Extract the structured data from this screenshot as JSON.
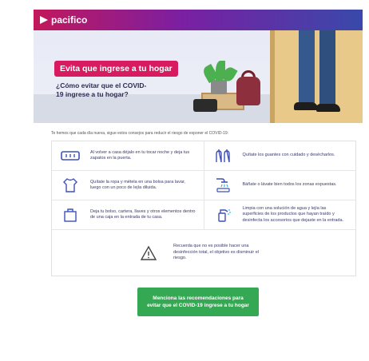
{
  "header": {
    "logo_text": "pacifico",
    "brand_color": "#c2185b"
  },
  "hero": {
    "badge": "Evita que ingrese a tu hogar",
    "question": "¿Cómo evitar que el COVID-19 ingrese a tu hogar?"
  },
  "intro": "Te hemos que cada día nueva, sigue estos consejos para reducir el riesgo de exponer el COVID-19:",
  "tips": [
    {
      "icon": "doormat-icon",
      "text": "Al volver a casa déjalo en tu tocar noche y deja tus zapatos en la puerta."
    },
    {
      "icon": "gloves-icon",
      "text": "Quítate los guantes con cuidado y desécharlos."
    },
    {
      "icon": "shirt-icon",
      "text": "Quítate la ropa y métela en una bolsa para lavar, luego con un poco de lejía diluida."
    },
    {
      "icon": "shower-icon",
      "text": "Báñate o lávate bien todos los zonas expuestas."
    },
    {
      "icon": "box-icon",
      "text": "Deja tu bolso, cartera, llaves y otros elementos dentro de una caja en la entrada de tu casa."
    },
    {
      "icon": "spray-icon",
      "text": "Limpia con una solución de agua y lejía las superficies de los productos que hayan traído y desinfecta los accesorios que dejaste en la entrada."
    }
  ],
  "notice": {
    "icon": "warning-icon",
    "text": "Recuerda que no es posible hacer una desinfección total, el objetivo es disminuir el riesgo."
  },
  "cta": {
    "label": "Menciona las recomendaciones para evitar que el COVID-19 ingrese a tu hogar",
    "color": "#34a853"
  }
}
